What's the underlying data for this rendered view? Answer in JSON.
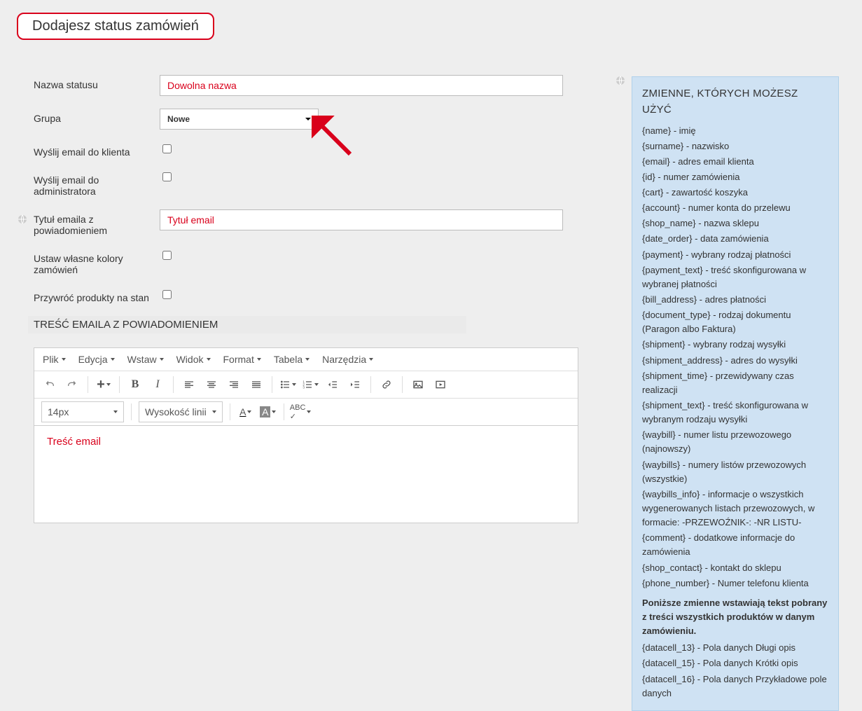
{
  "page": {
    "title": "Dodajesz status zamówień"
  },
  "form": {
    "status_name": {
      "label": "Nazwa statusu",
      "placeholder": "Dowolna nazwa"
    },
    "group": {
      "label": "Grupa",
      "value": "Nowe"
    },
    "send_client": {
      "label": "Wyślij email do klienta"
    },
    "send_admin": {
      "label": "Wyślij email do administratora"
    },
    "email_title": {
      "label": "Tytuł emaila z powiadomieniem",
      "placeholder": "Tytuł email"
    },
    "custom_colors": {
      "label": "Ustaw własne kolory zamówień"
    },
    "restore_stock": {
      "label": "Przywróć produkty na stan"
    }
  },
  "email_section": {
    "title": "TREŚĆ EMAILA Z POWIADOMIENIEM"
  },
  "editor": {
    "menu": [
      "Plik",
      "Edycja",
      "Wstaw",
      "Widok",
      "Format",
      "Tabela",
      "Narzędzia"
    ],
    "fontsize": "14px",
    "lineheight_label": "Wysokość linii",
    "body_placeholder": "Treść email"
  },
  "sidebar": {
    "title": "ZMIENNE, KTÓRYCH MOŻESZ UŻYĆ",
    "vars": [
      "{name} - imię",
      "{surname} - nazwisko",
      "{email} - adres email klienta",
      "{id} - numer zamówienia",
      "{cart} - zawartość koszyka",
      "{account} - numer konta do przelewu",
      "{shop_name} - nazwa sklepu",
      "{date_order} - data zamówienia",
      "{payment} - wybrany rodzaj płatności",
      "{payment_text} - treść skonfigurowana w wybranej płatności",
      "{bill_address} - adres płatności",
      "{document_type} - rodzaj dokumentu (Paragon albo Faktura)",
      "{shipment} - wybrany rodzaj wysyłki",
      "{shipment_address} - adres do wysyłki",
      "{shipment_time} - przewidywany czas realizacji",
      "{shipment_text} - treść skonfigurowana w wybranym rodzaju wysyłki",
      "{waybill} - numer listu przewozowego (najnowszy)",
      "{waybills} - numery listów przewozowych (wszystkie)",
      "{waybills_info} - informacje o wszystkich wygenerowanych listach przewozowych, w formacie: -PRZEWOŹNIK-: -NR LISTU-",
      "{comment} - dodatkowe informacje do zamówienia",
      "{shop_contact} - kontakt do sklepu",
      "{phone_number} - Numer telefonu klienta"
    ],
    "extra_title": "Poniższe zmienne wstawiają tekst pobrany z treści wszystkich produktów w danym zamówieniu.",
    "extra_vars": [
      "{datacell_13} - Pola danych Długi opis",
      "{datacell_15} - Pola danych Krótki opis",
      "{datacell_16} - Pola danych Przykładowe pole danych"
    ]
  }
}
